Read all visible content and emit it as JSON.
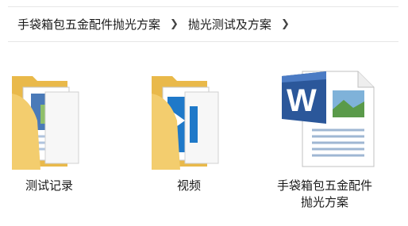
{
  "breadcrumb": {
    "items": [
      {
        "label": "手袋箱包五金配件抛光方案"
      },
      {
        "label": "抛光测试及方案"
      }
    ],
    "separator_icon": "chevron-right-icon"
  },
  "items": [
    {
      "name": "测试记录",
      "type": "folder",
      "icon": "folder-with-documents-icon"
    },
    {
      "name": "视频",
      "type": "folder",
      "icon": "folder-with-video-icon"
    },
    {
      "name": "手袋箱包五金配件抛光方案",
      "type": "word-document",
      "icon": "word-document-icon"
    }
  ],
  "colors": {
    "folder": "#f3cd6e",
    "word_blue": "#2b579a"
  }
}
